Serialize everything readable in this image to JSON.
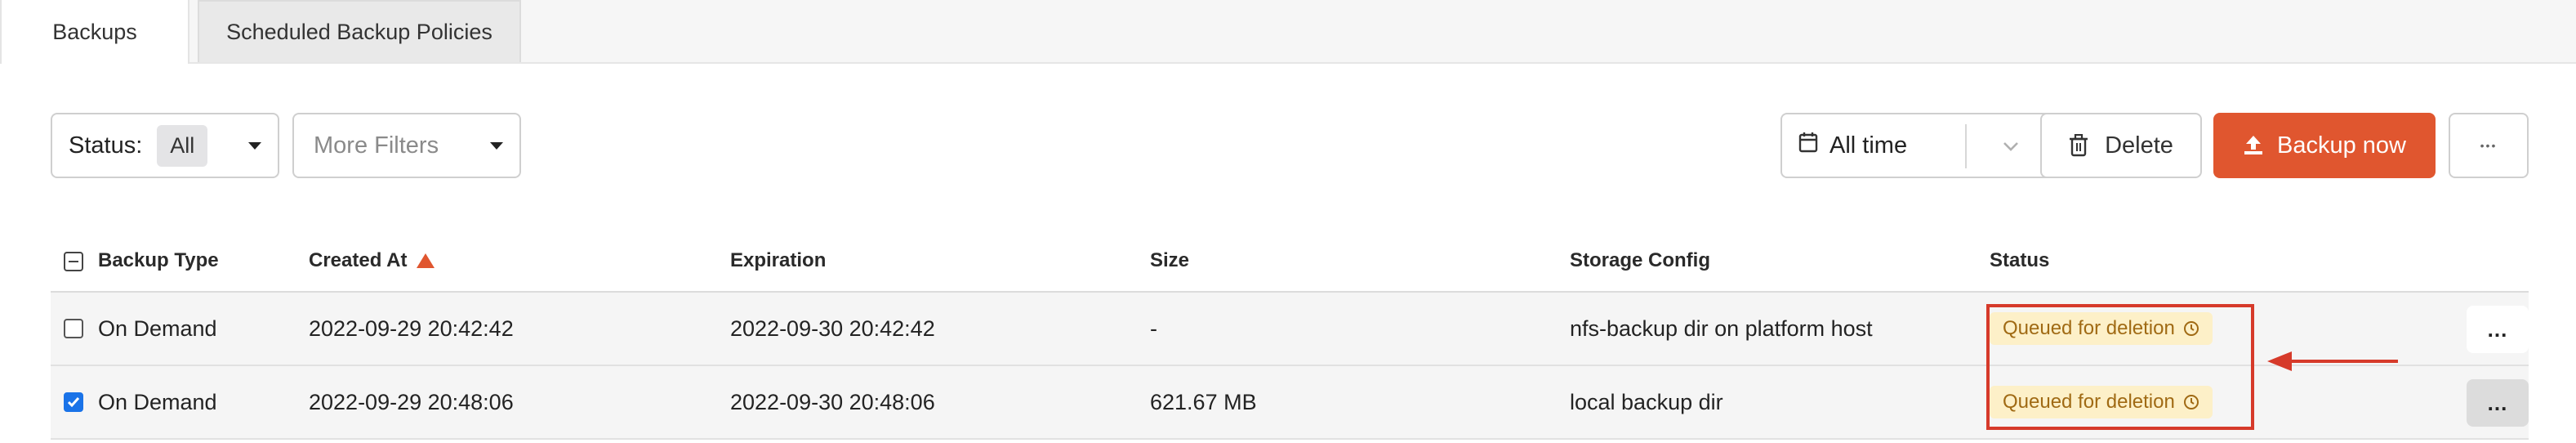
{
  "tabs": [
    {
      "label": "Backups",
      "active": true
    },
    {
      "label": "Scheduled Backup Policies",
      "active": false
    }
  ],
  "toolbar": {
    "status_filter_label": "Status:",
    "status_filter_value": "All",
    "more_filters_placeholder": "More Filters",
    "time_filter_value": "All time",
    "delete_label": "Delete",
    "backup_now_label": "Backup now",
    "more_actions_label": "•••"
  },
  "table": {
    "columns": [
      "Backup Type",
      "Created At",
      "Expiration",
      "Size",
      "Storage Config",
      "Status"
    ],
    "sort": {
      "column": "Created At",
      "direction": "ascending"
    },
    "rows": [
      {
        "selected": false,
        "backup_type": "On Demand",
        "created_at": "2022-09-29 20:42:42",
        "expiration": "2022-09-30 20:42:42",
        "size": "-",
        "storage_config": "nfs-backup dir on platform host",
        "status": "Queued for deletion",
        "action_label": "..."
      },
      {
        "selected": true,
        "backup_type": "On Demand",
        "created_at": "2022-09-29 20:48:06",
        "expiration": "2022-09-30 20:48:06",
        "size": "621.67 MB",
        "storage_config": "local backup dir",
        "status": "Queued for deletion",
        "action_label": "..."
      }
    ]
  },
  "colors": {
    "accent": "#e0562f",
    "status_badge_bg": "#fdf0c8",
    "status_badge_text": "#a06a14",
    "annotation": "#d63a2a",
    "checkbox_checked": "#1a73e8"
  },
  "icons": {
    "calendar": "calendar-icon",
    "chevron": "chevron-down-icon",
    "trash": "trash-icon",
    "upload": "upload-icon",
    "clock": "clock-icon",
    "sort": "sort-ascending-icon",
    "annotation_arrow": "arrow-left-icon"
  }
}
